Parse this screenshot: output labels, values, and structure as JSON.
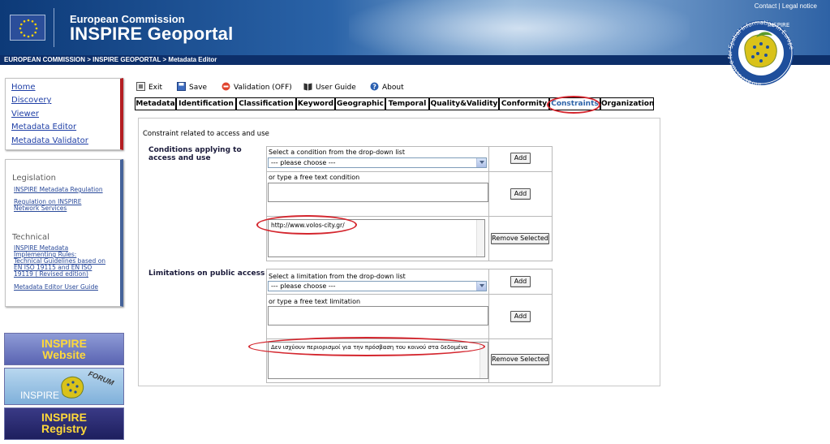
{
  "header": {
    "commission": "European Commission",
    "portal": "INSPIRE Geoportal",
    "contact": "Contact",
    "separator": "|",
    "legal": "Legal notice",
    "breadcrumb": "EUROPEAN COMMISSION > INSPIRE GEOPORTAL > Metadata Editor",
    "seal_word": "INSPIRE",
    "seal_ring": "Infrastructure for Spatial Information in Europe"
  },
  "sidebar": {
    "nav": [
      "Home",
      "Discovery",
      "Viewer",
      "Metadata Editor",
      "Metadata Validator"
    ],
    "legislation_title": "Legislation",
    "legislation_links": [
      "INSPIRE Metadata Regulation",
      "Regulation on INSPIRE\nNetwork Services"
    ],
    "technical_title": "Technical",
    "technical_links": [
      "INSPIRE Metadata\nImplementing Rules:\nTechnical Guidelines based on\nEN ISO 19115 and EN ISO\n19119 ( Revised edition)",
      "Metadata Editor User Guide"
    ],
    "banners": {
      "website_line1": "INSPIRE",
      "website_line2": "Website",
      "forum_inspire": "INSPIRE",
      "forum_word": "FORUM",
      "registry_line1": "INSPIRE",
      "registry_line2": "Registry"
    }
  },
  "toolbar": {
    "exit": "Exit",
    "save": "Save",
    "validation": "Validation (OFF)",
    "user_guide": "User Guide",
    "about": "About"
  },
  "tabs": [
    "Metadata",
    "Identification",
    "Classification",
    "Keyword",
    "Geographic",
    "Temporal",
    "Quality&Validity",
    "Conformity",
    "Constraints",
    "Organization"
  ],
  "active_tab": "Constraints",
  "form": {
    "section_title": "Constraint related to access and use",
    "conditions": {
      "label_line1": "Conditions applying to",
      "label_line2": "access and use",
      "select_hint": "Select a condition from the drop-down list",
      "select_value": "--- please choose ---",
      "free_hint": "or type a free text condition",
      "free_value": "",
      "list_value": "http://www.volos-city.gr/",
      "add1": "Add",
      "add2": "Add",
      "remove": "Remove Selected"
    },
    "limitations": {
      "label": "Limitations on public access",
      "select_hint": "Select a limitation from the drop-down list",
      "select_value": "--- please choose ---",
      "free_hint": "or type a free text limitation",
      "free_value": "",
      "list_value": "Δεν ισχύουν περιορισμοί για την πρόσβαση του κοινού στα δεδομένα",
      "add1": "Add",
      "add2": "Add",
      "remove": "Remove Selected"
    }
  },
  "colors": {
    "header_dark": "#0d2f6a",
    "link_blue": "#1f3fa6",
    "highlight_red": "#d4262e",
    "active_tab": "#2f64a8"
  }
}
